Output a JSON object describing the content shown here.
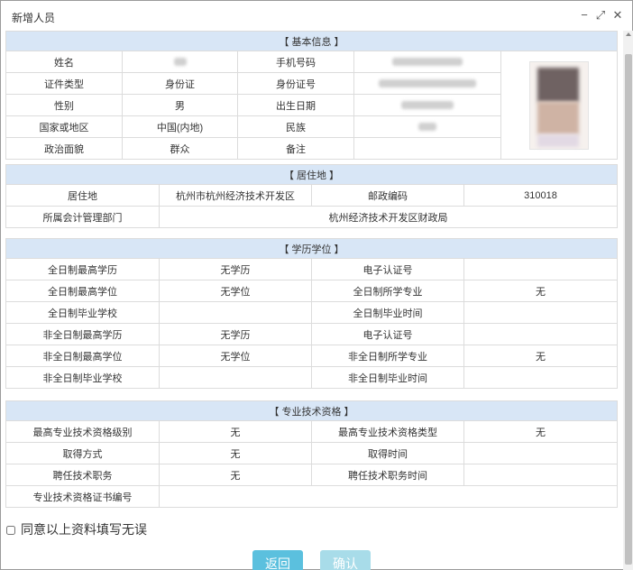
{
  "dialog": {
    "title": "新增人员",
    "minimize_icon": "minimize-icon",
    "maximize_icon": "maximize-icon",
    "close_icon": "close-icon",
    "minimize_glyph": "−",
    "maximize_glyph": "⤢",
    "close_glyph": "✕"
  },
  "basic": {
    "header": "【 基本信息 】",
    "name_label": "姓名",
    "phone_label": "手机号码",
    "id_type_label": "证件类型",
    "id_type_value": "身份证",
    "id_no_label": "身份证号",
    "gender_label": "性别",
    "gender_value": "男",
    "birth_label": "出生日期",
    "region_label": "国家或地区",
    "region_value": "中国(内地)",
    "ethnic_label": "民族",
    "political_label": "政治面貌",
    "political_value": "群众",
    "remark_label": "备注"
  },
  "residence": {
    "header": "【 居住地 】",
    "residence_label": "居住地",
    "residence_value": "杭州市杭州经济技术开发区",
    "postcode_label": "邮政编码",
    "postcode_value": "310018",
    "dept_label": "所属会计管理部门",
    "dept_value": "杭州经济技术开发区财政局"
  },
  "education": {
    "header": "【 学历学位 】",
    "ft_edu_label": "全日制最高学历",
    "ft_edu_value": "无学历",
    "ft_cert_label": "电子认证号",
    "ft_degree_label": "全日制最高学位",
    "ft_degree_value": "无学位",
    "ft_major_label": "全日制所学专业",
    "ft_major_value": "无",
    "ft_school_label": "全日制毕业学校",
    "ft_grad_time_label": "全日制毕业时间",
    "pt_edu_label": "非全日制最高学历",
    "pt_edu_value": "无学历",
    "pt_cert_label": "电子认证号",
    "pt_degree_label": "非全日制最高学位",
    "pt_degree_value": "无学位",
    "pt_major_label": "非全日制所学专业",
    "pt_major_value": "无",
    "pt_school_label": "非全日制毕业学校",
    "pt_grad_time_label": "非全日制毕业时间"
  },
  "qualification": {
    "header": "【 专业技术资格 】",
    "level_label": "最高专业技术资格级别",
    "level_value": "无",
    "type_label": "最高专业技术资格类型",
    "type_value": "无",
    "method_label": "取得方式",
    "method_value": "无",
    "obtain_time_label": "取得时间",
    "post_label": "聘任技术职务",
    "post_value": "无",
    "post_time_label": "聘任技术职务时间",
    "cert_no_label": "专业技术资格证书编号"
  },
  "footer": {
    "agree_label": "同意以上资料填写无误",
    "back_button": "返回",
    "confirm_button": "确认"
  }
}
